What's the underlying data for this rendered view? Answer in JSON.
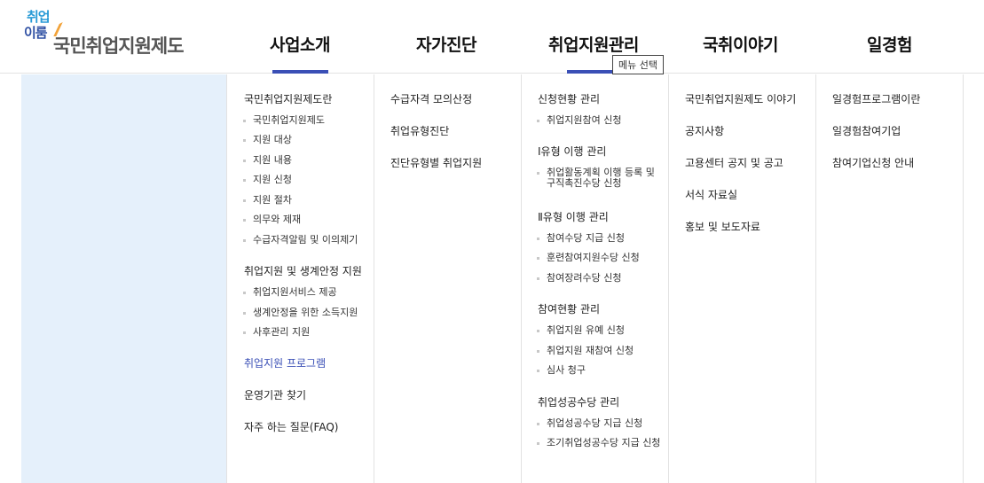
{
  "logo": {
    "mark_line1": "취업",
    "mark_line2": "이룸",
    "text": "국민취업지원제도"
  },
  "gnb": [
    {
      "label": "사업소개"
    },
    {
      "label": "자가진단"
    },
    {
      "label": "취업지원관리"
    },
    {
      "label": "국취이야기"
    },
    {
      "label": "일경험"
    }
  ],
  "tooltip": "메뉴 선택",
  "columns": [
    {
      "sections": [
        {
          "title": "국민취업지원제도란",
          "items": [
            "국민취업지원제도",
            "지원 대상",
            "지원 내용",
            "지원 신청",
            "지원 절차",
            "의무와 제재",
            "수급자격알림 및 이의제기"
          ]
        },
        {
          "title": "취업지원 및 생계안정 지원",
          "items": [
            "취업지원서비스 제공",
            "생계안정을 위한 소득지원",
            "사후관리 지원"
          ]
        },
        {
          "title": "취업지원 프로그램",
          "items": []
        },
        {
          "title": "운영기관 찾기",
          "items": []
        },
        {
          "title": "자주 하는 질문(FAQ)",
          "items": []
        }
      ]
    },
    {
      "sections": [
        {
          "title": "수급자격 모의산정",
          "items": []
        },
        {
          "title": "취업유형진단",
          "items": []
        },
        {
          "title": "진단유형별 취업지원",
          "items": []
        }
      ]
    },
    {
      "sections": [
        {
          "title": "신청현황 관리",
          "items": [
            "취업지원참여 신청"
          ]
        },
        {
          "title": "Ⅰ유형 이행 관리",
          "items": [
            "취업활동계획 이행 등록 및 구직촉진수당 신청"
          ]
        },
        {
          "title": "Ⅱ유형 이행 관리",
          "items": [
            "참여수당 지급 신청",
            "훈련참여지원수당 신청",
            "참여장려수당 신청"
          ]
        },
        {
          "title": "참여현황 관리",
          "items": [
            "취업지원 유예 신청",
            "취업지원 재참여 신청",
            "심사 청구"
          ]
        },
        {
          "title": "취업성공수당 관리",
          "items": [
            "취업성공수당 지급 신청",
            "조기취업성공수당 지급 신청"
          ]
        }
      ]
    },
    {
      "sections": [
        {
          "title": "국민취업지원제도 이야기",
          "items": []
        },
        {
          "title": "공지사항",
          "items": []
        },
        {
          "title": "고용센터 공지 및 공고",
          "items": []
        },
        {
          "title": "서식 자료실",
          "items": []
        },
        {
          "title": "홍보 및 보도자료",
          "items": []
        }
      ]
    },
    {
      "sections": [
        {
          "title": "일경험프로그램이란",
          "items": []
        },
        {
          "title": "일경험참여기업",
          "items": []
        },
        {
          "title": "참여기업신청 안내",
          "items": []
        }
      ]
    }
  ]
}
